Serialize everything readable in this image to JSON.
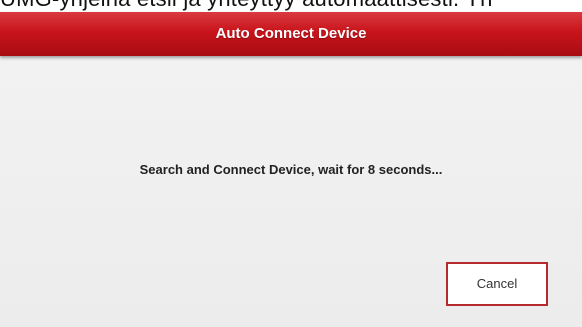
{
  "top_caption": "UMG-yhjeinä etsii ja yhteyttyy automaattisesti. Yh",
  "dialog": {
    "title": "Auto Connect Device",
    "message": "Search and Connect Device, wait for 8 seconds...",
    "cancel_label": "Cancel"
  },
  "colors": {
    "titlebar": "#c8141b",
    "button_border": "#b52a2e",
    "dialog_background": "#efefef"
  }
}
